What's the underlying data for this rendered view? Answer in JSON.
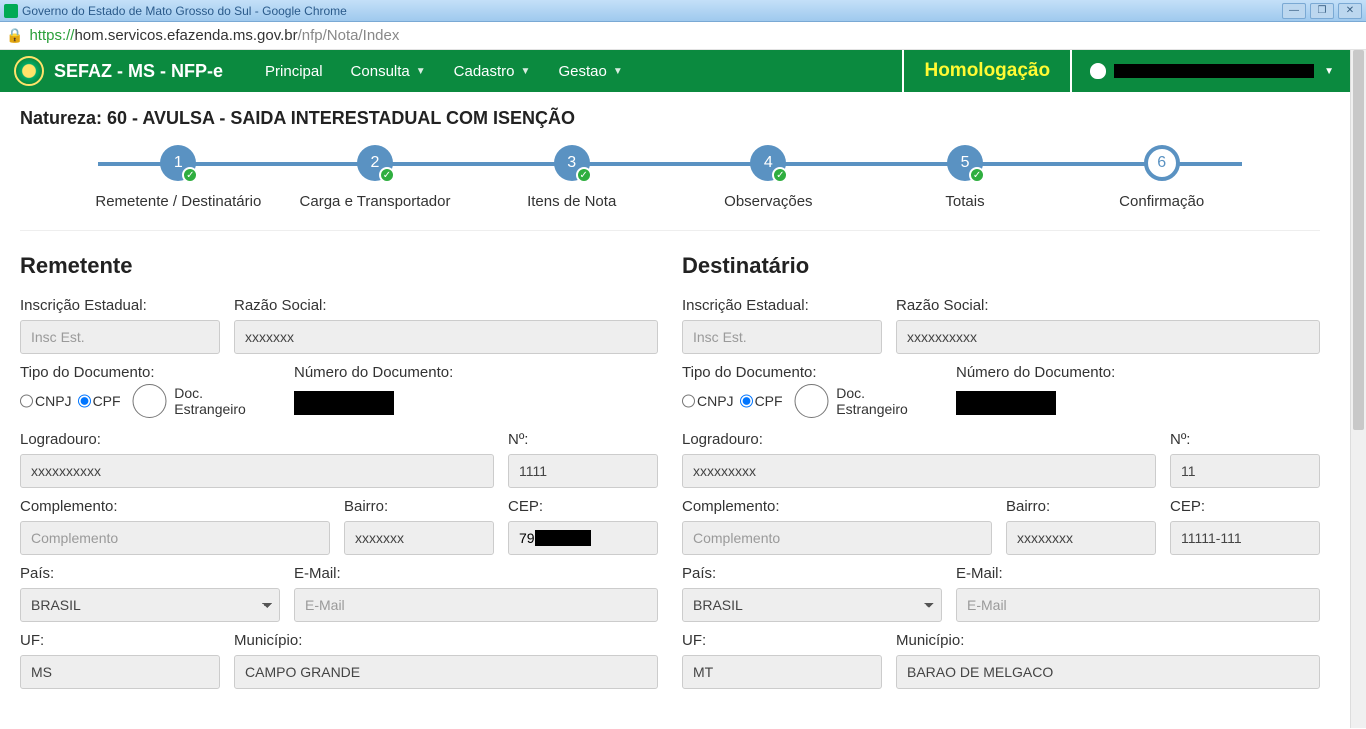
{
  "browser": {
    "title": "Governo do Estado de Mato Grosso do Sul - Google Chrome",
    "url_proto": "https://",
    "url_host": "hom.servicos.efazenda.ms.gov.br",
    "url_path": "/nfp/Nota/Index"
  },
  "nav": {
    "brand": "SEFAZ - MS - NFP-e",
    "items": [
      "Principal",
      "Consulta",
      "Cadastro",
      "Gestao"
    ],
    "env_badge": "Homologação"
  },
  "page": {
    "natureza": "Natureza: 60 - AVULSA - SAIDA INTERESTADUAL COM ISENÇÃO",
    "steps": [
      {
        "num": "1",
        "label": "Remetente / Destinatário",
        "done": true
      },
      {
        "num": "2",
        "label": "Carga e Transportador",
        "done": true
      },
      {
        "num": "3",
        "label": "Itens de Nota",
        "done": true
      },
      {
        "num": "4",
        "label": "Observações",
        "done": true
      },
      {
        "num": "5",
        "label": "Totais",
        "done": true
      },
      {
        "num": "6",
        "label": "Confirmação",
        "done": false,
        "current": true
      }
    ]
  },
  "labels": {
    "insc": "Inscrição Estadual:",
    "razao": "Razão Social:",
    "tipodoc": "Tipo do Documento:",
    "numdoc": "Número do Documento:",
    "cnpj": "CNPJ",
    "cpf": "CPF",
    "doce": "Doc. Estrangeiro",
    "log": "Logradouro:",
    "num": "Nº:",
    "comp": "Complemento:",
    "bairro": "Bairro:",
    "cep": "CEP:",
    "pais": "País:",
    "email": "E-Mail:",
    "uf": "UF:",
    "mun": "Município:"
  },
  "placeholders": {
    "insc": "Insc Est.",
    "comp": "Complemento",
    "email": "E-Mail"
  },
  "remetente": {
    "title": "Remetente",
    "razao": "xxxxxxx",
    "doc_type": "CPF",
    "logradouro": "xxxxxxxxxx",
    "numero": "1111",
    "bairro": "xxxxxxx",
    "cep_prefix": "79",
    "pais": "BRASIL",
    "uf": "MS",
    "municipio": "CAMPO GRANDE"
  },
  "destinatario": {
    "title": "Destinatário",
    "razao": "xxxxxxxxxx",
    "doc_type": "CPF",
    "logradouro": "xxxxxxxxx",
    "numero": "11",
    "bairro": "xxxxxxxx",
    "cep": "11111-111",
    "pais": "BRASIL",
    "uf": "MT",
    "municipio": "BARAO DE MELGACO"
  }
}
